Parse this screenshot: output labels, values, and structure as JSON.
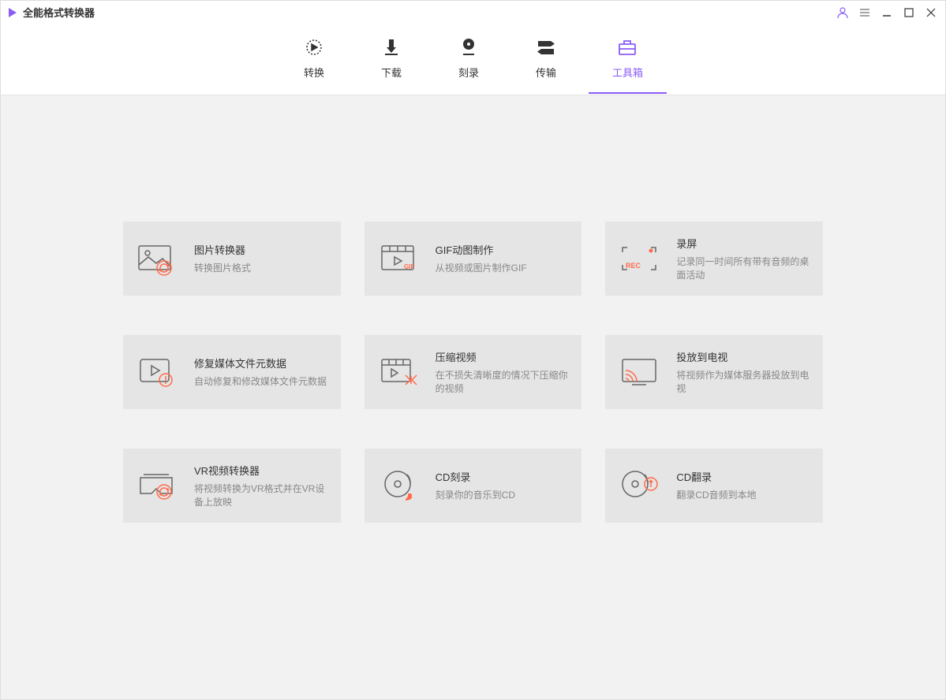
{
  "app": {
    "title": "全能格式转换器"
  },
  "nav": {
    "tabs": [
      {
        "label": "转换"
      },
      {
        "label": "下载"
      },
      {
        "label": "刻录"
      },
      {
        "label": "传输"
      },
      {
        "label": "工具箱"
      }
    ]
  },
  "tools": [
    {
      "title": "图片转换器",
      "desc": "转换图片格式"
    },
    {
      "title": "GIF动图制作",
      "desc": "从视频或图片制作GIF"
    },
    {
      "title": "录屏",
      "desc": "记录同一时间所有带有音频的桌面活动"
    },
    {
      "title": "修复媒体文件元数据",
      "desc": "自动修复和修改媒体文件元数据"
    },
    {
      "title": "压缩视频",
      "desc": "在不损失清晰度的情况下压缩你的视频"
    },
    {
      "title": "投放到电视",
      "desc": "将视频作为媒体服务器投放到电视"
    },
    {
      "title": "VR视频转换器",
      "desc": "将视频转换为VR格式并在VR设备上放映"
    },
    {
      "title": "CD刻录",
      "desc": "刻录你的音乐到CD"
    },
    {
      "title": "CD翻录",
      "desc": "翻录CD音频到本地"
    }
  ]
}
